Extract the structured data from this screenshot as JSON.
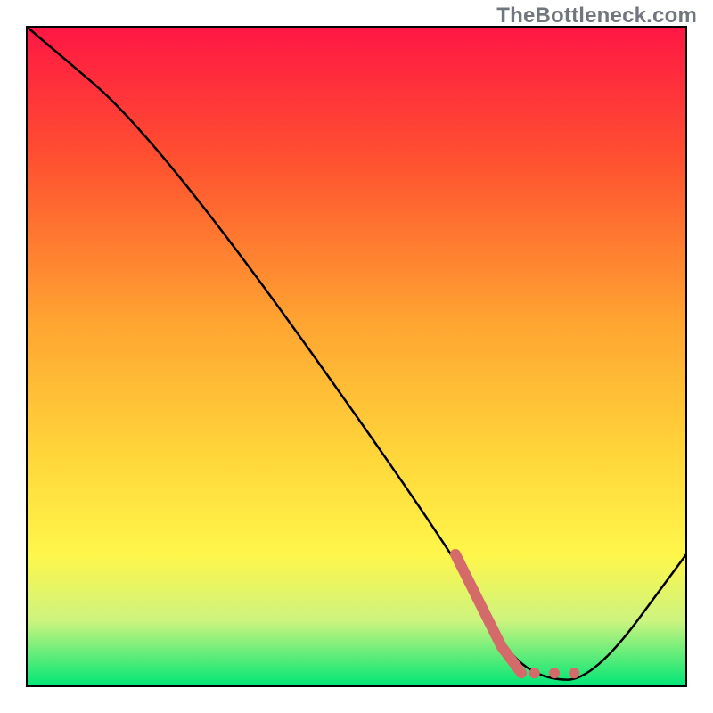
{
  "watermark_text": "TheBottleneck.com",
  "chart_data": {
    "type": "line",
    "title": "",
    "xlabel": "",
    "ylabel": "",
    "axis_ranges": {
      "x": [
        0,
        100
      ],
      "y": [
        0,
        100
      ]
    },
    "series": [
      {
        "name": "black-curve",
        "color": "#000000",
        "points": [
          {
            "x": 0,
            "y": 100
          },
          {
            "x": 20,
            "y": 83
          },
          {
            "x": 65,
            "y": 20
          },
          {
            "x": 72,
            "y": 6
          },
          {
            "x": 78,
            "y": 1
          },
          {
            "x": 86,
            "y": 1
          },
          {
            "x": 100,
            "y": 20
          }
        ]
      },
      {
        "name": "red-highlight",
        "color": "#d46a6a",
        "points": [
          {
            "x": 65,
            "y": 20
          },
          {
            "x": 72,
            "y": 6
          },
          {
            "x": 75,
            "y": 2
          }
        ]
      }
    ],
    "annotations": {
      "red_dots": [
        {
          "x": 77,
          "y": 2
        },
        {
          "x": 80,
          "y": 2
        },
        {
          "x": 83,
          "y": 2
        }
      ]
    },
    "background_gradient": {
      "orientation": "vertical",
      "stops": [
        {
          "offset": 0.0,
          "color": "#ff1744"
        },
        {
          "offset": 0.2,
          "color": "#ff5030"
        },
        {
          "offset": 0.45,
          "color": "#ffa531"
        },
        {
          "offset": 0.65,
          "color": "#ffd63a"
        },
        {
          "offset": 0.8,
          "color": "#fff64a"
        },
        {
          "offset": 0.9,
          "color": "#cdf47e"
        },
        {
          "offset": 1.0,
          "color": "#00e676"
        }
      ]
    },
    "border_color": "#000000"
  }
}
